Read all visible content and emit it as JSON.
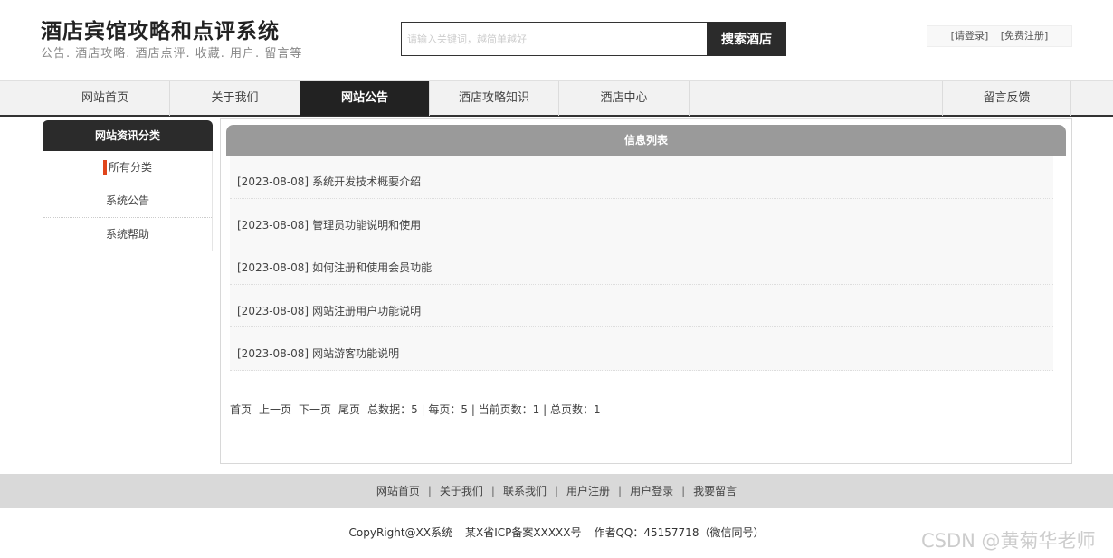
{
  "header": {
    "title": "酒店宾馆攻略和点评系统",
    "subtitle": "公告. 酒店攻略. 酒店点评. 收藏. 用户. 留言等",
    "search_placeholder": "请输入关键词，越简单越好",
    "search_button": "搜索酒店",
    "login_link": "[请登录]",
    "register_link": "[免费注册]"
  },
  "nav": {
    "items": [
      {
        "label": "网站首页"
      },
      {
        "label": "关于我们"
      },
      {
        "label": "网站公告"
      },
      {
        "label": "酒店攻略知识"
      },
      {
        "label": "酒店中心"
      },
      {
        "label": "留言反馈"
      }
    ],
    "active_index": 2
  },
  "sidebar": {
    "title": "网站资讯分类",
    "items": [
      {
        "label": "所有分类"
      },
      {
        "label": "系统公告"
      },
      {
        "label": "系统帮助"
      }
    ]
  },
  "main": {
    "title": "信息列表",
    "items": [
      {
        "date": "[2023-08-08]",
        "title": "系统开发技术概要介绍"
      },
      {
        "date": "[2023-08-08]",
        "title": "管理员功能说明和使用"
      },
      {
        "date": "[2023-08-08]",
        "title": "如何注册和使用会员功能"
      },
      {
        "date": "[2023-08-08]",
        "title": "网站注册用户功能说明"
      },
      {
        "date": "[2023-08-08]",
        "title": "网站游客功能说明"
      }
    ],
    "pager": {
      "first": "首页",
      "prev": "上一页",
      "next": "下一页",
      "last": "尾页",
      "info": "总数据：5 | 每页：5 | 当前页数：1 | 总页数：1"
    }
  },
  "footer": {
    "links": [
      "网站首页",
      "关于我们",
      "联系我们",
      "用户注册",
      "用户登录",
      "我要留言"
    ],
    "separator": "|",
    "copyright": "CopyRight@XX系统",
    "icp": "某X省ICP备案XXXXX号",
    "author": "作者QQ：45157718（微信同号）"
  },
  "watermark": "CSDN @黄菊华老师",
  "colors": {
    "accent_dark": "#222222",
    "sidebar_mark": "#e0451b",
    "list_header": "#9a9a9a",
    "footer_bg": "#d9d9d9"
  }
}
